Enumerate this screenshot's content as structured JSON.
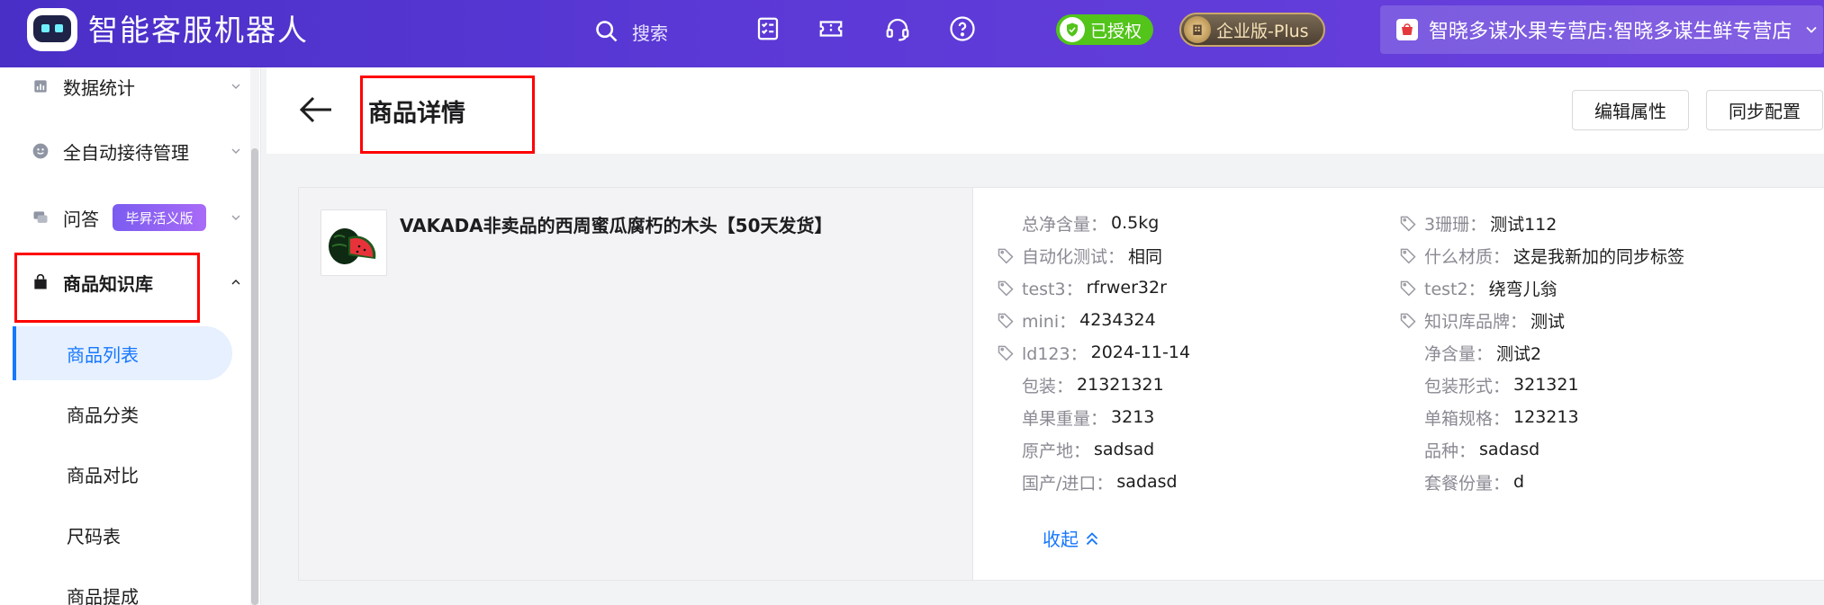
{
  "header": {
    "brand": "智能客服机器人",
    "search_label": "搜索",
    "badge_auth": "已授权",
    "badge_edition": "企业版-Plus",
    "shop_name": "智晓多谋水果专营店:智晓多谋生鲜专营店"
  },
  "sidebar": {
    "items": [
      {
        "label": "数据统计",
        "icon": "bar-chart-icon"
      },
      {
        "label": "全自动接待管理",
        "icon": "face-icon"
      },
      {
        "label": "问答",
        "icon": "chat-icon",
        "tag": "毕昇活义版"
      },
      {
        "label": "商品知识库",
        "icon": "bag-icon"
      }
    ],
    "subitems": [
      "商品列表",
      "商品分类",
      "商品对比",
      "尺码表",
      "商品提成"
    ]
  },
  "page": {
    "title": "商品详情",
    "edit_button": "编辑属性",
    "sync_button": "同步配置"
  },
  "product": {
    "name": "VAKADA非卖品的西周蜜瓜腐朽的木头【50天发货】",
    "attributes_left": [
      {
        "key": "总净含量：",
        "value": "0.5kg",
        "tag": false
      },
      {
        "key": "自动化测试：",
        "value": "相同",
        "tag": true
      },
      {
        "key": "test3：",
        "value": "rfrwer32r",
        "tag": true
      },
      {
        "key": "mini：",
        "value": "4234324",
        "tag": true
      },
      {
        "key": "ld123：",
        "value": "2024-11-14",
        "tag": true
      },
      {
        "key": "包装：",
        "value": "21321321",
        "tag": false
      },
      {
        "key": "单果重量：",
        "value": "3213",
        "tag": false
      },
      {
        "key": "原产地：",
        "value": "sadsad",
        "tag": false
      },
      {
        "key": "国产/进口：",
        "value": "sadasd",
        "tag": false
      }
    ],
    "attributes_right": [
      {
        "key": "3珊珊：",
        "value": "测试112",
        "tag": true
      },
      {
        "key": "什么材质：",
        "value": "这是我新加的同步标签",
        "tag": true
      },
      {
        "key": "test2：",
        "value": "绕弯儿翁",
        "tag": true
      },
      {
        "key": "知识库品牌：",
        "value": "测试",
        "tag": true
      },
      {
        "key": "净含量：",
        "value": "测试2",
        "tag": false
      },
      {
        "key": "包装形式：",
        "value": "321321",
        "tag": false
      },
      {
        "key": "单箱规格：",
        "value": "123213",
        "tag": false
      },
      {
        "key": "品种：",
        "value": "sadasd",
        "tag": false
      },
      {
        "key": "套餐份量：",
        "value": "d",
        "tag": false
      }
    ],
    "collapse_label": "收起"
  }
}
